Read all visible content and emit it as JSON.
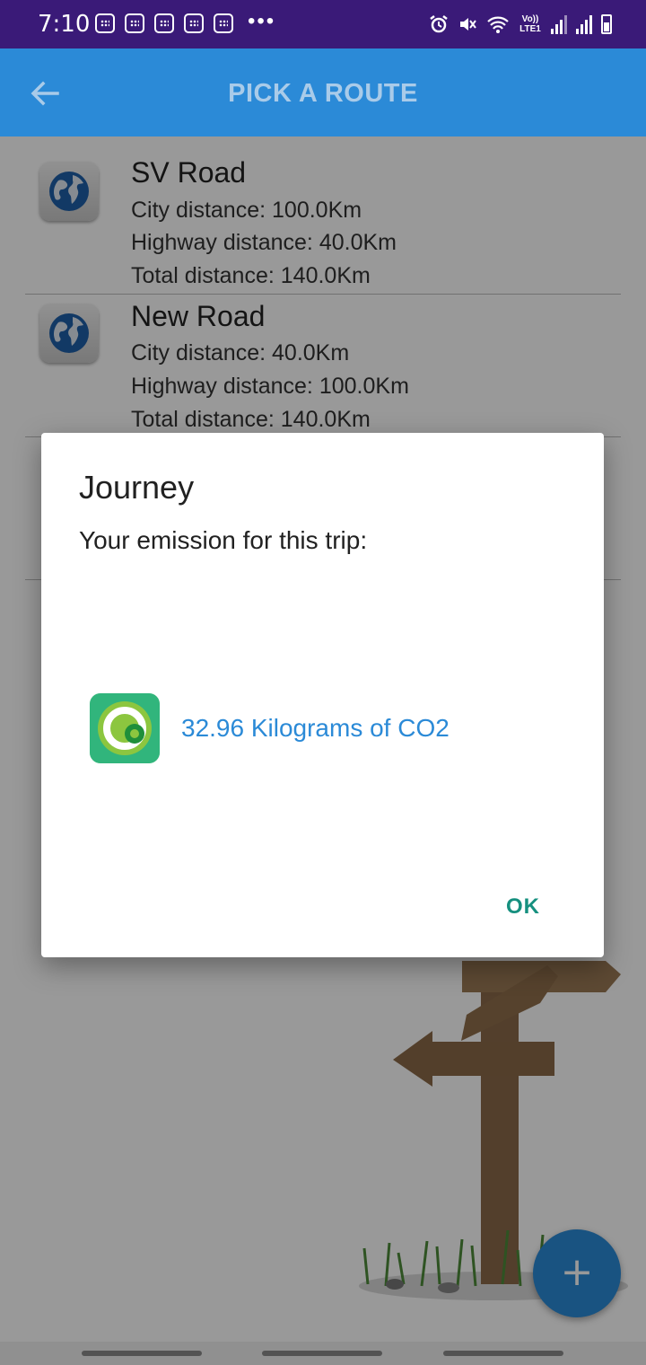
{
  "status_bar": {
    "time": "7:10",
    "more": "•••",
    "network": "Vo)) LTE1"
  },
  "app_bar": {
    "title": "PICK A ROUTE",
    "back_icon": "arrow-left-icon"
  },
  "routes": [
    {
      "name": "SV Road",
      "city": "City distance: 100.0Km",
      "highway": "Highway distance: 40.0Km",
      "total": "Total distance: 140.0Km",
      "icon": "globe-icon"
    },
    {
      "name": "New Road",
      "city": "City distance: 40.0Km",
      "highway": "Highway distance: 100.0Km",
      "total": "Total distance: 140.0Km",
      "icon": "globe-icon"
    }
  ],
  "dialog": {
    "title": "Journey",
    "message": "Your emission for this trip:",
    "emission": "32.96 Kilograms of CO2",
    "ok_label": "OK",
    "icon": "app-logo-icon"
  },
  "fab": {
    "label": "+"
  },
  "colors": {
    "status_bar": "#3a1a78",
    "primary": "#2b8ad7",
    "dialog_button": "#16907f"
  }
}
